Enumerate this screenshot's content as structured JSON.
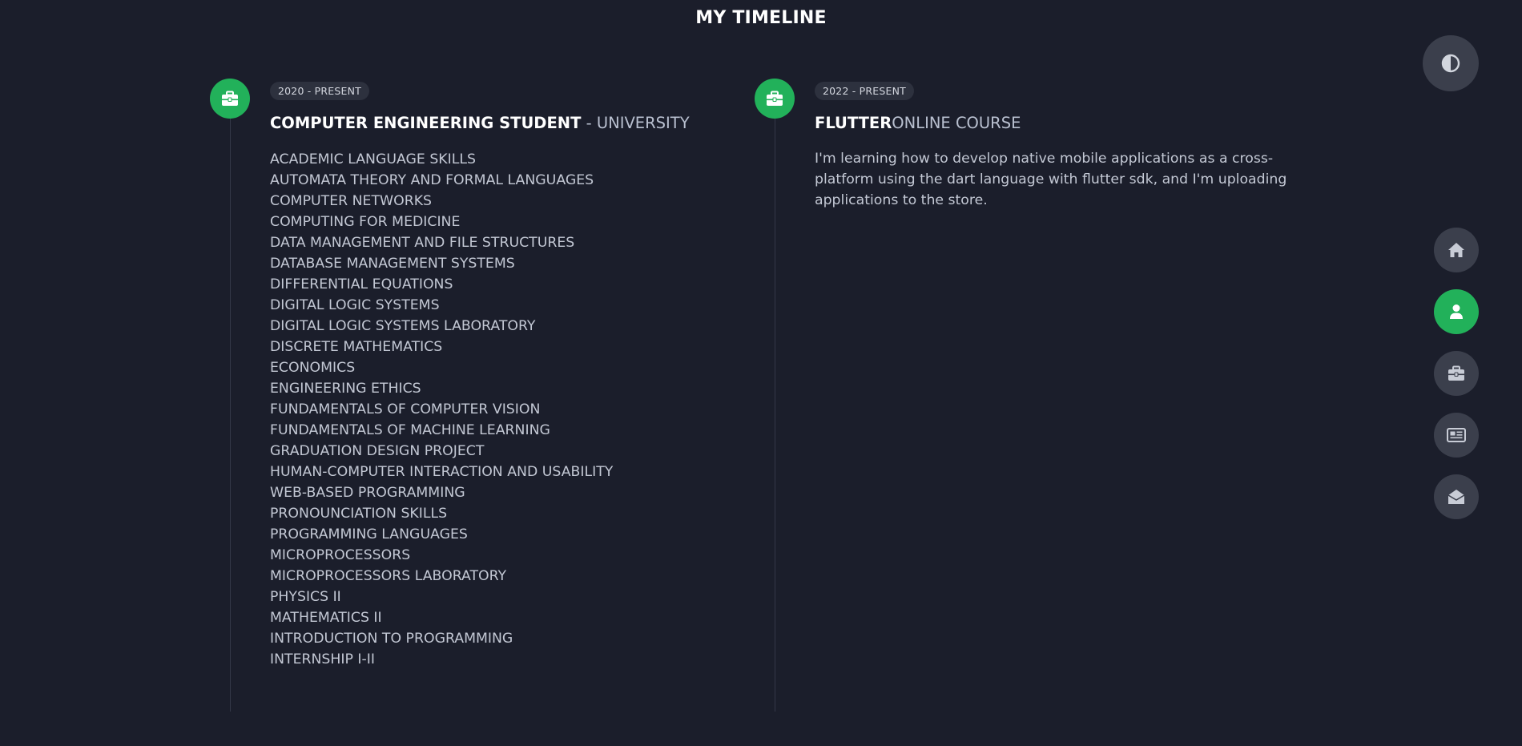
{
  "page": {
    "title": "MY TIMELINE"
  },
  "colors": {
    "background": "#1b1e2b",
    "accent": "#22b15a",
    "button": "#3b3f4c",
    "badge": "#2d313e"
  },
  "timeline": [
    {
      "date": "2020 - PRESENT",
      "icon": "briefcase-icon",
      "title_strong": "COMPUTER ENGINEERING STUDENT",
      "title_light": " - UNIVERSITY",
      "courses": [
        "ACADEMIC LANGUAGE SKILLS",
        "AUTOMATA THEORY AND FORMAL LANGUAGES",
        "COMPUTER NETWORKS",
        "COMPUTING FOR MEDICINE",
        "DATA MANAGEMENT AND FILE STRUCTURES",
        "DATABASE MANAGEMENT SYSTEMS",
        "DIFFERENTIAL EQUATIONS",
        "DIGITAL LOGIC SYSTEMS",
        "DIGITAL LOGIC SYSTEMS LABORATORY",
        "DISCRETE MATHEMATICS",
        "ECONOMICS",
        "ENGINEERING ETHICS",
        "FUNDAMENTALS OF COMPUTER VISION",
        "FUNDAMENTALS OF MACHINE LEARNING",
        "GRADUATION DESIGN PROJECT",
        "HUMAN-COMPUTER INTERACTION AND USABILITY",
        "WEB-BASED PROGRAMMING",
        "PRONOUNCIATION SKILLS",
        "PROGRAMMING LANGUAGES",
        "MICROPROCESSORS",
        "MICROPROCESSORS LABORATORY",
        "PHYSICS II",
        "MATHEMATICS II",
        "INTRODUCTION TO PROGRAMMING",
        "INTERNSHIP I-II"
      ]
    },
    {
      "date": "2022 - PRESENT",
      "icon": "briefcase-icon",
      "title_strong": "FLUTTER",
      "title_light": "ONLINE COURSE",
      "description": "I'm learning how to develop native mobile applications as a cross-platform using the dart language with flutter sdk, and I'm uploading applications to the store."
    }
  ],
  "theme_toggle": {
    "icon": "contrast-icon"
  },
  "side_nav": [
    {
      "icon": "home-icon",
      "active": false
    },
    {
      "icon": "user-icon",
      "active": true
    },
    {
      "icon": "briefcase-icon",
      "active": false
    },
    {
      "icon": "newspaper-icon",
      "active": false
    },
    {
      "icon": "envelope-open-icon",
      "active": false
    }
  ]
}
